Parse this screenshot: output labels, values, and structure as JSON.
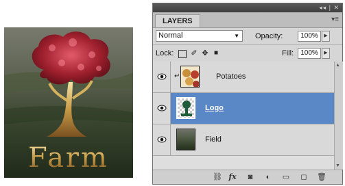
{
  "artwork": {
    "title_text": "Farm",
    "description_colors": {
      "sky_top": "#6b6f64",
      "field": "#3d4a32",
      "tree_red": "#b52a3a",
      "trunk_gold": "#d6b25a"
    }
  },
  "panel": {
    "tab_label": "LAYERS",
    "titlebar_controls": "◂◂ | ✕",
    "menu_icon": "panel-menu-icon",
    "blend_mode": "Normal",
    "opacity_label": "Opacity:",
    "opacity_value": "100%",
    "lock_label": "Lock:",
    "fill_label": "Fill:",
    "fill_value": "100%"
  },
  "layers": [
    {
      "name": "Potatoes",
      "visible": true,
      "clipped": true,
      "selected": false
    },
    {
      "name": "Logo",
      "visible": true,
      "clipped": false,
      "selected": true
    },
    {
      "name": "Field",
      "visible": true,
      "clipped": false,
      "selected": false
    }
  ],
  "bottom_icons": [
    "link-icon",
    "fx-icon",
    "mask-icon",
    "adjustment-icon",
    "folder-icon",
    "new-layer-icon",
    "trash-icon"
  ],
  "colors": {
    "selection": "#5a87c6",
    "panel_bg": "#d6d6d6"
  }
}
